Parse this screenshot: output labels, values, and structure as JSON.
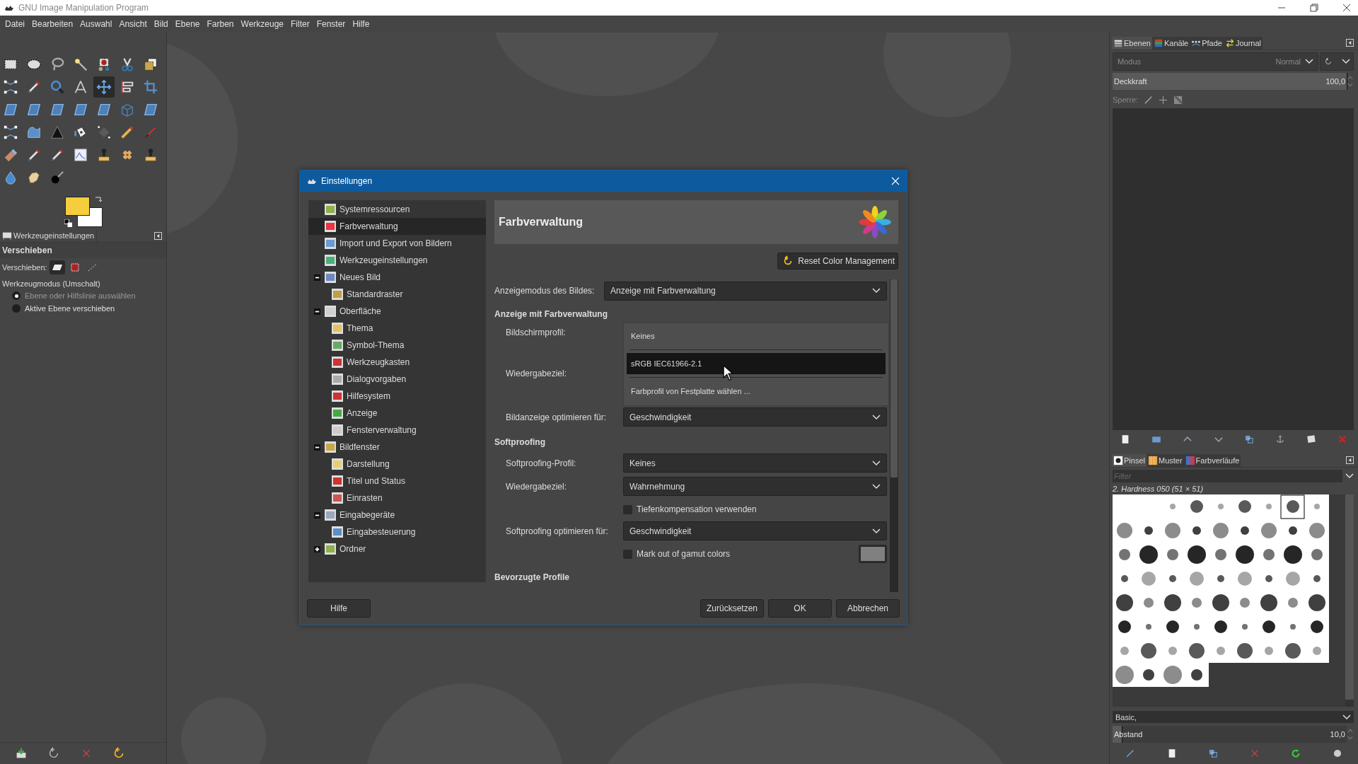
{
  "window": {
    "title": "GNU Image Manipulation Program"
  },
  "menu": [
    "Datei",
    "Bearbeiten",
    "Auswahl",
    "Ansicht",
    "Bild",
    "Ebene",
    "Farben",
    "Werkzeuge",
    "Filter",
    "Fenster",
    "Hilfe"
  ],
  "toolbox": {
    "tools": [
      {
        "selected": false
      },
      {
        "selected": false
      },
      {
        "selected": false
      },
      {
        "selected": false
      },
      {
        "selected": false
      },
      {
        "selected": false
      },
      {
        "selected": false
      },
      {
        "selected": false
      },
      {
        "selected": false
      },
      {
        "selected": false
      },
      {
        "selected": false
      },
      {
        "selected": true
      },
      {
        "selected": false
      },
      {
        "selected": false
      },
      {
        "selected": false
      },
      {
        "selected": false
      },
      {
        "selected": false
      },
      {
        "selected": false
      },
      {
        "selected": false
      },
      {
        "selected": false
      },
      {
        "selected": false
      },
      {
        "selected": false
      },
      {
        "selected": false
      },
      {
        "selected": false
      },
      {
        "selected": false
      },
      {
        "selected": false
      },
      {
        "selected": false
      },
      {
        "selected": false
      },
      {
        "selected": false
      },
      {
        "selected": false
      },
      {
        "selected": false
      },
      {
        "selected": false
      },
      {
        "selected": false
      },
      {
        "selected": false
      },
      {
        "selected": false
      },
      {
        "selected": false
      },
      {
        "selected": false
      },
      {
        "selected": false
      }
    ],
    "swatches": [
      {
        "kind": "foreground",
        "color": "#f6cd3d"
      },
      {
        "kind": "background",
        "color": "#ffffff"
      }
    ]
  },
  "tool_options": {
    "tab": "Werkzeugeinstellungen",
    "title": "Verschieben",
    "move_label": "Verschieben:",
    "move_modes": [
      {
        "selected": true
      },
      {
        "selected": false
      },
      {
        "selected": false
      }
    ],
    "mode_label": "Werkzeugmodus (Umschalt)",
    "mode_options": [
      {
        "label": "Ebene oder Hilfslinie auswählen",
        "selected": true
      },
      {
        "label": "Aktive Ebene verschieben",
        "selected": false
      }
    ]
  },
  "dialog": {
    "title": "Einstellungen",
    "tree": [
      {
        "label": "Systemressourcen",
        "selected": false
      },
      {
        "label": "Farbverwaltung",
        "selected": true
      },
      {
        "label": "Import und Export von Bildern",
        "selected": false
      },
      {
        "label": "Werkzeugeinstellungen",
        "selected": false
      },
      {
        "label": "Neues Bild",
        "selected": false,
        "expanded": true,
        "children": [
          {
            "label": "Standardraster",
            "selected": false
          }
        ]
      },
      {
        "label": "Oberfläche",
        "selected": false,
        "expanded": true,
        "children": [
          {
            "label": "Thema",
            "selected": false
          },
          {
            "label": "Symbol-Thema",
            "selected": false
          },
          {
            "label": "Werkzeugkasten",
            "selected": false
          },
          {
            "label": "Dialogvorgaben",
            "selected": false
          },
          {
            "label": "Hilfesystem",
            "selected": false
          },
          {
            "label": "Anzeige",
            "selected": false
          },
          {
            "label": "Fensterverwaltung",
            "selected": false
          }
        ]
      },
      {
        "label": "Bildfenster",
        "selected": false,
        "expanded": true,
        "children": [
          {
            "label": "Darstellung",
            "selected": false
          },
          {
            "label": "Titel und Status",
            "selected": false
          },
          {
            "label": "Einrasten",
            "selected": false
          }
        ]
      },
      {
        "label": "Eingabegeräte",
        "selected": false,
        "expanded": true,
        "children": [
          {
            "label": "Eingabesteuerung",
            "selected": false
          }
        ]
      },
      {
        "label": "Ordner",
        "selected": false,
        "expanded": false
      }
    ],
    "page": {
      "title": "Farbverwaltung",
      "reset_button": "Reset Color Management",
      "rows": [
        {
          "kind": "mode",
          "label": "Anzeigemodus des Bildes:",
          "value": "Anzeige mit Farbverwaltung"
        },
        {
          "kind": "heading",
          "label": "Anzeige mit Farbverwaltung"
        },
        {
          "kind": "field",
          "label": "Bildschirmprofil:"
        },
        {
          "kind": "field",
          "label": "Wiedergabeziel:"
        },
        {
          "kind": "select",
          "label": "Bildanzeige optimieren für:",
          "value": "Geschwindigkeit"
        },
        {
          "kind": "heading",
          "label": "Softproofing"
        },
        {
          "kind": "select",
          "label": "Softproofing-Profil:",
          "value": "Keines"
        },
        {
          "kind": "select",
          "label": "Wiedergabeziel:",
          "value": "Wahrnehmung"
        },
        {
          "kind": "check",
          "label": "Tiefenkompensation verwenden",
          "checked": false
        },
        {
          "kind": "select",
          "label": "Softproofing optimieren für:",
          "value": "Geschwindigkeit"
        },
        {
          "kind": "check",
          "label": "Mark out of gamut colors",
          "checked": false,
          "color": "#808080"
        },
        {
          "kind": "heading",
          "label": "Bevorzugte Profile"
        }
      ]
    },
    "popup": {
      "items": [
        {
          "label": "Keines",
          "selected": false
        },
        {
          "label": "sRGB IEC61966-2.1",
          "selected": true
        },
        {
          "label": "Farbprofil von Festplatte wählen ...",
          "selected": false
        }
      ]
    },
    "help_button": "Hilfe",
    "buttons": [
      "Zurücksetzen",
      "OK",
      "Abbrechen"
    ]
  },
  "layers_dock": {
    "tabs": [
      {
        "label": "Ebenen",
        "selected": true
      },
      {
        "label": "Kanäle",
        "selected": false
      },
      {
        "label": "Pfade",
        "selected": false
      },
      {
        "label": "Journal",
        "selected": false
      }
    ],
    "mode_label": "Modus",
    "mode_value": "Normal",
    "opacity": {
      "label": "Deckkraft",
      "value": "100,0",
      "level": 1
    },
    "lock_label": "Sperre:"
  },
  "brushes_dock": {
    "tabs": [
      {
        "label": "Pinsel",
        "selected": true
      },
      {
        "label": "Muster",
        "selected": false
      },
      {
        "label": "Farbverläufe",
        "selected": false
      }
    ],
    "filter_placeholder": "Filter",
    "brush_name": "2. Hardness 050 (51 × 51)",
    "tag_value": "Basic,",
    "spacing": {
      "label": "Abstand",
      "value": "10,0",
      "level": 0.04
    }
  }
}
